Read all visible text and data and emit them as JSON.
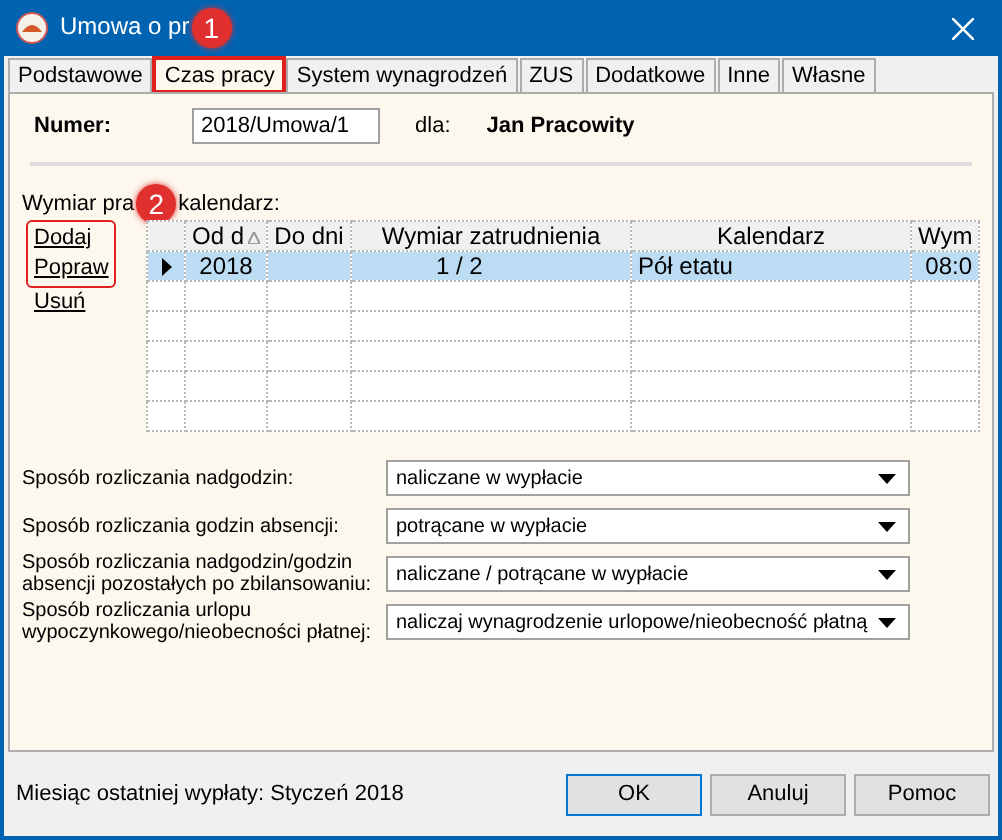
{
  "window": {
    "title": "Umowa o pr"
  },
  "annotations": [
    {
      "number": "1"
    },
    {
      "number": "2"
    }
  ],
  "tabs": [
    {
      "label": "Podstawowe",
      "selected": false,
      "highlighted": false
    },
    {
      "label": "Czas pracy",
      "selected": true,
      "highlighted": true
    },
    {
      "label": "System wynagrodzeń",
      "selected": false,
      "highlighted": false
    },
    {
      "label": "ZUS",
      "selected": false,
      "highlighted": false
    },
    {
      "label": "Dodatkowe",
      "selected": false,
      "highlighted": false
    },
    {
      "label": "Inne",
      "selected": false,
      "highlighted": false
    },
    {
      "label": "Własne",
      "selected": false,
      "highlighted": false
    }
  ],
  "header": {
    "number_label": "Numer:",
    "number_value": "2018/Umowa/1",
    "for_label": "dla:",
    "employee": "Jan Pracowity"
  },
  "section": {
    "label_before": "Wymiar pra",
    "label_after": "kalendarz:"
  },
  "links": [
    {
      "label": "Dodaj",
      "highlighted": true
    },
    {
      "label": "Popraw",
      "highlighted": true
    },
    {
      "label": "Usuń",
      "highlighted": false
    }
  ],
  "grid": {
    "columns": [
      {
        "label": "Od d",
        "sorted": true
      },
      {
        "label": "Do dni",
        "sorted": false
      },
      {
        "label": "Wymiar zatrudnienia",
        "sorted": false
      },
      {
        "label": "Kalendarz",
        "sorted": false
      },
      {
        "label": "Wym",
        "sorted": false
      }
    ],
    "rows": [
      {
        "selected": true,
        "cells": [
          "2018",
          "",
          "1 / 2",
          "Pół etatu",
          "08:0"
        ]
      }
    ]
  },
  "settings": [
    {
      "label": "Sposób rozliczania nadgodzin:",
      "value": "naliczane w wypłacie"
    },
    {
      "label": "Sposób rozliczania godzin absencji:",
      "value": "potrącane w wypłacie"
    },
    {
      "label": "Sposób rozliczania nadgodzin/godzin absencji pozostałych po zbilansowaniu:",
      "value": "naliczane / potrącane w wypłacie"
    },
    {
      "label": "Sposób rozliczania urlopu wypoczynkowego/nieobecności płatnej:",
      "value": "naliczaj wynagrodzenie urlopowe/nieobecność płatną"
    }
  ],
  "status": "Miesiąc ostatniej wypłaty: Styczeń 2018",
  "buttons": [
    "OK",
    "Anuluj",
    "Pomoc"
  ]
}
